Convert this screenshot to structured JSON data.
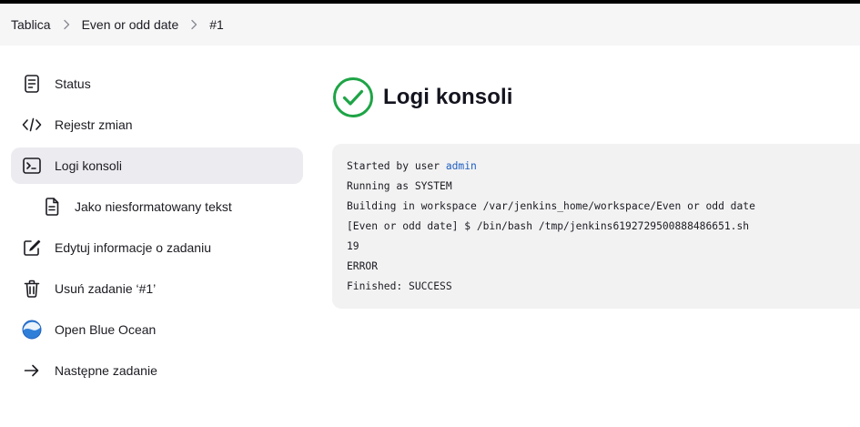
{
  "breadcrumb": [
    "Tablica",
    "Even or odd date",
    "#1"
  ],
  "sidebar": {
    "items": [
      {
        "label": "Status",
        "icon": "document-icon"
      },
      {
        "label": "Rejestr zmian",
        "icon": "code-icon"
      },
      {
        "label": "Logi konsoli",
        "icon": "terminal-icon",
        "active": true
      },
      {
        "label": "Jako niesformatowany tekst",
        "icon": "text-file-icon",
        "sub": true
      },
      {
        "label": "Edytuj informacje o zadaniu",
        "icon": "edit-icon"
      },
      {
        "label": "Usuń zadanie ‘#1’",
        "icon": "trash-icon"
      },
      {
        "label": "Open Blue Ocean",
        "icon": "blue-ocean-icon"
      },
      {
        "label": "Następne zadanie",
        "icon": "arrow-right-icon"
      }
    ]
  },
  "main": {
    "title": "Logi konsoli",
    "status_icon": "success-check-icon",
    "status_color": "#1ea446"
  },
  "console": {
    "started_prefix": "Started by user ",
    "started_user": "admin",
    "lines": [
      "Running as SYSTEM",
      "Building in workspace /var/jenkins_home/workspace/Even or odd date",
      "[Even or odd date] $ /bin/bash /tmp/jenkins6192729500888486651.sh",
      "19",
      "ERROR",
      "Finished: SUCCESS"
    ]
  },
  "colors": {
    "link": "#1f5fbf",
    "active_bg": "#ececf0",
    "console_bg": "#f2f2f3"
  }
}
